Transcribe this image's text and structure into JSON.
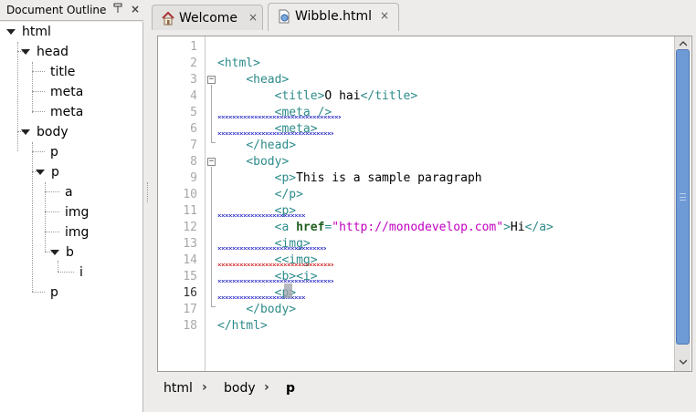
{
  "outline": {
    "title": "Document Outline",
    "pin_icon": "pin-icon",
    "close_icon": "close-icon",
    "nodes": [
      {
        "label": "html"
      },
      {
        "label": "head"
      },
      {
        "label": "title"
      },
      {
        "label": "meta"
      },
      {
        "label": "meta"
      },
      {
        "label": "body"
      },
      {
        "label": "p"
      },
      {
        "label": "p"
      },
      {
        "label": "a"
      },
      {
        "label": "img"
      },
      {
        "label": "img"
      },
      {
        "label": "b"
      },
      {
        "label": "i"
      },
      {
        "label": "p"
      }
    ]
  },
  "tabs": [
    {
      "label": "Welcome",
      "icon": "home-icon",
      "close": "×"
    },
    {
      "label": "Wibble.html",
      "icon": "html-file-icon",
      "close": "×"
    }
  ],
  "editor": {
    "line_numbers": [
      "1",
      "2",
      "3",
      "4",
      "5",
      "6",
      "7",
      "8",
      "9",
      "10",
      "11",
      "12",
      "13",
      "14",
      "15",
      "16",
      "17",
      "18"
    ],
    "current_line": "16",
    "lines": [
      [],
      [
        {
          "t": "tag",
          "v": "<html>"
        }
      ],
      [
        {
          "t": "txt",
          "v": "    "
        },
        {
          "t": "tag",
          "v": "<head>"
        }
      ],
      [
        {
          "t": "txt",
          "v": "        "
        },
        {
          "t": "tag",
          "v": "<title>"
        },
        {
          "t": "txt",
          "v": "O hai"
        },
        {
          "t": "tag",
          "v": "</title>"
        }
      ],
      [
        {
          "t": "txt",
          "v": "        "
        },
        {
          "t": "tag",
          "v": "<meta />"
        }
      ],
      [
        {
          "t": "txt",
          "v": "        "
        },
        {
          "t": "tag",
          "v": "<meta>"
        }
      ],
      [
        {
          "t": "txt",
          "v": "    "
        },
        {
          "t": "tag",
          "v": "</head>"
        }
      ],
      [
        {
          "t": "txt",
          "v": "    "
        },
        {
          "t": "tag",
          "v": "<body>"
        }
      ],
      [
        {
          "t": "txt",
          "v": "        "
        },
        {
          "t": "tag",
          "v": "<p>"
        },
        {
          "t": "txt",
          "v": "This is a sample paragraph"
        }
      ],
      [
        {
          "t": "txt",
          "v": "        "
        },
        {
          "t": "tag",
          "v": "</p>"
        }
      ],
      [
        {
          "t": "txt",
          "v": "        "
        },
        {
          "t": "tag",
          "v": "<p>"
        }
      ],
      [
        {
          "t": "txt",
          "v": "        "
        },
        {
          "t": "tag",
          "v": "<a "
        },
        {
          "t": "attr",
          "v": "href"
        },
        {
          "t": "tag",
          "v": "="
        },
        {
          "t": "val",
          "v": "\"http://monodevelop.com\""
        },
        {
          "t": "tag",
          "v": ">"
        },
        {
          "t": "txt",
          "v": "Hi"
        },
        {
          "t": "tag",
          "v": "</a>"
        }
      ],
      [
        {
          "t": "txt",
          "v": "        "
        },
        {
          "t": "tag",
          "v": "<img>"
        }
      ],
      [
        {
          "t": "txt",
          "v": "        "
        },
        {
          "t": "tag",
          "v": "<<img>"
        }
      ],
      [
        {
          "t": "txt",
          "v": "        "
        },
        {
          "t": "tag",
          "v": "<b><i>"
        }
      ],
      [
        {
          "t": "txt",
          "v": "        "
        },
        {
          "t": "tag",
          "v": "<p>"
        }
      ],
      [
        {
          "t": "txt",
          "v": "    "
        },
        {
          "t": "tag",
          "v": "</body>"
        }
      ],
      [
        {
          "t": "tag",
          "v": "</html>"
        }
      ]
    ]
  },
  "scrollbar": {
    "up_icon": "arrow-up-icon",
    "down_icon": "arrow-down-icon"
  },
  "breadcrumb": {
    "items": [
      "html",
      "body",
      "p"
    ],
    "separator": "›"
  }
}
